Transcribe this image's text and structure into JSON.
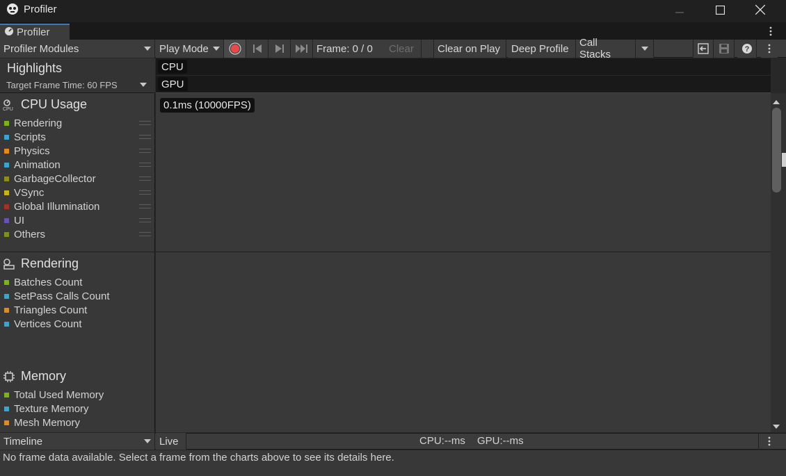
{
  "window": {
    "title": "Profiler"
  },
  "tab": {
    "label": "Profiler"
  },
  "toolbar": {
    "modules_label": "Profiler Modules",
    "play_mode_label": "Play Mode",
    "frame_label": "Frame: 0 / 0",
    "clear_label": "Clear",
    "clear_on_play_label": "Clear on Play",
    "deep_profile_label": "Deep Profile",
    "call_stacks_label": "Call Stacks"
  },
  "highlights": {
    "title": "Highlights",
    "target_frame_label": "Target Frame Time: 60 FPS",
    "lanes": [
      "CPU",
      "GPU"
    ]
  },
  "modules": {
    "cpu": {
      "title": "CPU Usage",
      "items": [
        {
          "label": "Rendering",
          "color": "#7cb21a"
        },
        {
          "label": "Scripts",
          "color": "#3ea4cc"
        },
        {
          "label": "Physics",
          "color": "#e08b20"
        },
        {
          "label": "Animation",
          "color": "#3ea4cc"
        },
        {
          "label": "GarbageCollector",
          "color": "#8d8d1e"
        },
        {
          "label": "VSync",
          "color": "#c8b41a"
        },
        {
          "label": "Global Illumination",
          "color": "#a13325"
        },
        {
          "label": "UI",
          "color": "#6a52b0"
        },
        {
          "label": "Others",
          "color": "#7a8f26"
        }
      ],
      "chart_label": "0.1ms (10000FPS)"
    },
    "rendering": {
      "title": "Rendering",
      "items": [
        {
          "label": "Batches Count",
          "color": "#7cb21a"
        },
        {
          "label": "SetPass Calls Count",
          "color": "#3ea4cc"
        },
        {
          "label": "Triangles Count",
          "color": "#e08b20"
        },
        {
          "label": "Vertices Count",
          "color": "#3ea4cc"
        }
      ]
    },
    "memory": {
      "title": "Memory",
      "items": [
        {
          "label": "Total Used Memory",
          "color": "#7cb21a"
        },
        {
          "label": "Texture Memory",
          "color": "#3ea4cc"
        },
        {
          "label": "Mesh Memory",
          "color": "#e08b20"
        }
      ]
    }
  },
  "bottom": {
    "view_label": "Timeline",
    "live_label": "Live",
    "cpu_label": "CPU:--ms",
    "gpu_label": "GPU:--ms",
    "details_text": "No frame data available. Select a frame from the charts above to see its details here."
  },
  "colors": {
    "record": "#e84a4a",
    "tab_accent": "#3a79bb"
  }
}
